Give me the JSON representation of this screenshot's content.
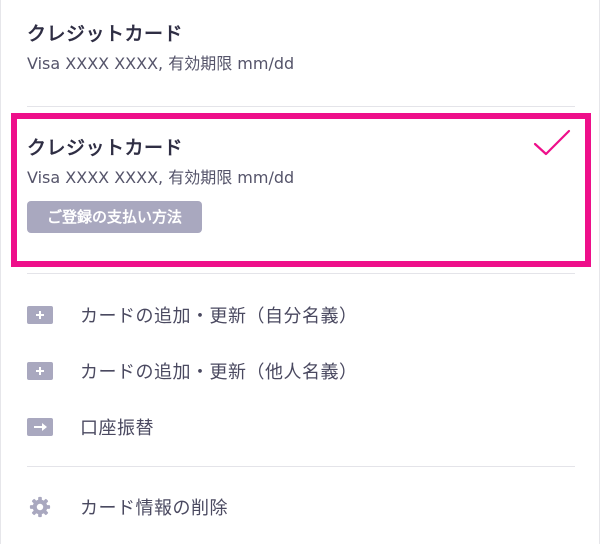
{
  "cards": [
    {
      "title": "クレジットカード",
      "detail": "Visa XXXX XXXX, 有効期限 mm/dd",
      "selected": false
    },
    {
      "title": "クレジットカード",
      "detail": "Visa XXXX XXXX, 有効期限 mm/dd",
      "selected": true,
      "badge": "ご登録の支払い方法"
    }
  ],
  "menu": [
    {
      "label": "カードの追加・更新（自分名義）",
      "icon": "plus-card-icon"
    },
    {
      "label": "カードの追加・更新（他人名義）",
      "icon": "plus-card-icon"
    },
    {
      "label": "口座振替",
      "icon": "arrow-right-box-icon"
    },
    {
      "label": "カード情報の削除",
      "icon": "gear-icon"
    }
  ],
  "colors": {
    "highlight": "#ee0f8a",
    "badge_bg": "#a9a8bf",
    "icon": "#a9a8bf",
    "text": "#2f2e44"
  }
}
